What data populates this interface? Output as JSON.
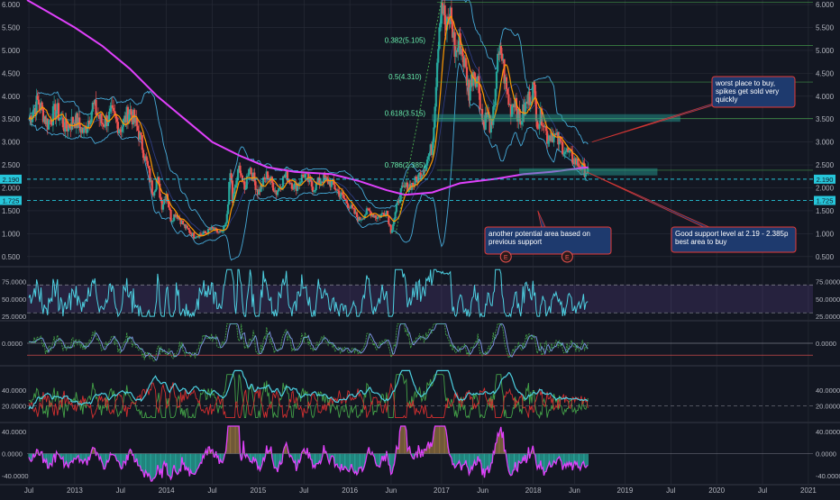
{
  "colors": {
    "background": "#131722",
    "axis_text": "#b2b5be",
    "grid": "#2a2e39",
    "candle_up": "#26a69a",
    "candle_down": "#ef5350",
    "ma200": "#e040fb",
    "ma_short": "#ff9800",
    "bollinger": "#4fc3f7",
    "fib_line": "#4caf50",
    "fib_text": "#69f0ae",
    "support_line": "#26c6da",
    "zone_fill": "#26a69a",
    "annotation_fill": "#1e3a6e",
    "annotation_border": "#e53935",
    "rsi_line": "#4dd0e1",
    "rsi_band": "#7e57c2",
    "hist_pos": "#8d6e3f",
    "hist_neg": "#26a69a",
    "osc_pink": "#e040fb",
    "dmi_green": "#43a047",
    "dmi_red": "#d32f2f"
  },
  "chart_data": [
    {
      "type": "candlestick",
      "panel": "price",
      "y_ticks": [
        "6.000",
        "5.500",
        "5.000",
        "4.500",
        "4.000",
        "3.500",
        "3.000",
        "2.500",
        "2.000",
        "1.500",
        "1.000",
        "0.500"
      ],
      "ylim": [
        0.3,
        6.1
      ],
      "x_ticks": [
        "Jul",
        "2013",
        "Jul",
        "2014",
        "Jul",
        "2015",
        "Jul",
        "2016",
        "Jun",
        "2017",
        "Jun",
        "2018",
        "Jun",
        "2019",
        "Jul",
        "2020",
        "Jul",
        "2021"
      ],
      "x_tick_dates": [
        2012.5,
        2013.0,
        2013.5,
        2014.0,
        2014.5,
        2015.0,
        2015.5,
        2016.0,
        2016.45,
        2017.0,
        2017.45,
        2018.0,
        2018.45,
        2019.0,
        2019.5,
        2020.0,
        2020.5,
        2021.0
      ],
      "xlim": [
        2012.48,
        2021.05
      ],
      "price_path": [
        [
          2012.5,
          3.5
        ],
        [
          2012.6,
          3.9
        ],
        [
          2012.7,
          3.4
        ],
        [
          2012.8,
          3.7
        ],
        [
          2012.9,
          3.3
        ],
        [
          2013.0,
          3.5
        ],
        [
          2013.1,
          3.2
        ],
        [
          2013.2,
          3.8
        ],
        [
          2013.3,
          3.4
        ],
        [
          2013.4,
          3.6
        ],
        [
          2013.5,
          3.3
        ],
        [
          2013.6,
          3.7
        ],
        [
          2013.7,
          3.2
        ],
        [
          2013.8,
          2.4
        ],
        [
          2013.85,
          1.9
        ],
        [
          2013.9,
          2.2
        ],
        [
          2013.95,
          1.6
        ],
        [
          2014.0,
          1.9
        ],
        [
          2014.05,
          1.3
        ],
        [
          2014.1,
          1.45
        ],
        [
          2014.2,
          1.15
        ],
        [
          2014.3,
          0.95
        ],
        [
          2014.4,
          1.0
        ],
        [
          2014.5,
          1.1
        ],
        [
          2014.6,
          1.0
        ],
        [
          2014.65,
          1.2
        ],
        [
          2014.7,
          2.4
        ],
        [
          2014.72,
          1.7
        ],
        [
          2014.8,
          2.5
        ],
        [
          2014.85,
          1.9
        ],
        [
          2014.9,
          2.5
        ],
        [
          2015.0,
          1.9
        ],
        [
          2015.1,
          2.3
        ],
        [
          2015.2,
          1.9
        ],
        [
          2015.3,
          2.3
        ],
        [
          2015.4,
          2.0
        ],
        [
          2015.5,
          2.3
        ],
        [
          2015.6,
          2.0
        ],
        [
          2015.7,
          2.2
        ],
        [
          2015.8,
          2.1
        ],
        [
          2015.9,
          1.85
        ],
        [
          2016.0,
          1.6
        ],
        [
          2016.1,
          1.3
        ],
        [
          2016.2,
          1.5
        ],
        [
          2016.3,
          1.35
        ],
        [
          2016.4,
          1.5
        ],
        [
          2016.45,
          1.05
        ],
        [
          2016.55,
          1.9
        ],
        [
          2016.6,
          2.0
        ],
        [
          2016.7,
          2.1
        ],
        [
          2016.8,
          2.4
        ],
        [
          2016.9,
          2.9
        ],
        [
          2016.97,
          5.5
        ],
        [
          2017.0,
          6.1
        ],
        [
          2017.05,
          5.4
        ],
        [
          2017.1,
          5.8
        ],
        [
          2017.15,
          4.9
        ],
        [
          2017.2,
          5.2
        ],
        [
          2017.25,
          4.7
        ],
        [
          2017.3,
          4.1
        ],
        [
          2017.35,
          4.6
        ],
        [
          2017.4,
          4.3
        ],
        [
          2017.45,
          3.4
        ],
        [
          2017.5,
          3.6
        ],
        [
          2017.55,
          3.2
        ],
        [
          2017.6,
          4.6
        ],
        [
          2017.65,
          5.0
        ],
        [
          2017.7,
          4.2
        ],
        [
          2017.75,
          3.7
        ],
        [
          2017.8,
          4.0
        ],
        [
          2017.85,
          3.4
        ],
        [
          2017.9,
          3.7
        ],
        [
          2018.0,
          4.2
        ],
        [
          2018.05,
          3.4
        ],
        [
          2018.1,
          3.6
        ],
        [
          2018.15,
          3.1
        ],
        [
          2018.2,
          3.2
        ],
        [
          2018.3,
          2.95
        ],
        [
          2018.4,
          2.7
        ],
        [
          2018.45,
          2.6
        ],
        [
          2018.5,
          2.5
        ],
        [
          2018.55,
          2.4
        ],
        [
          2018.6,
          2.35
        ]
      ],
      "annotations": {
        "fib_levels": [
          {
            "label": "0.382(5.105)",
            "value": 5.105
          },
          {
            "label": "0.5(4.310)",
            "value": 4.31
          },
          {
            "label": "0.618(3.515)",
            "value": 3.515
          },
          {
            "label": "0.786(2.385)",
            "value": 2.385
          }
        ],
        "horizontal_levels": [
          {
            "label": "2.190",
            "value": 2.19
          },
          {
            "label": "1.725",
            "value": 1.725
          }
        ],
        "callouts": [
          {
            "text": "worst place to buy, spikes get sold very quickly"
          },
          {
            "text": "another potential area based on previous support"
          },
          {
            "text": "Good support level at 2.19 - 2.385p best area to buy"
          }
        ],
        "event_markers": [
          "E",
          "E"
        ]
      }
    },
    {
      "type": "line",
      "panel": "rsi",
      "y_ticks": [
        "75.0000",
        "50.0000",
        "25.0000"
      ],
      "ylim": [
        20,
        95
      ],
      "band": [
        30,
        70
      ]
    },
    {
      "type": "line",
      "panel": "oscillator_1",
      "y_ticks": [
        "0.0000"
      ],
      "ylim": [
        -1,
        1
      ]
    },
    {
      "type": "line",
      "panel": "dmi",
      "y_ticks": [
        "40.0000",
        "20.0000"
      ],
      "ylim": [
        0,
        70
      ]
    },
    {
      "type": "bar",
      "panel": "oscillator_2",
      "y_ticks": [
        "40.0000",
        "0.0000",
        "-40.0000"
      ],
      "ylim": [
        -55,
        55
      ]
    }
  ]
}
